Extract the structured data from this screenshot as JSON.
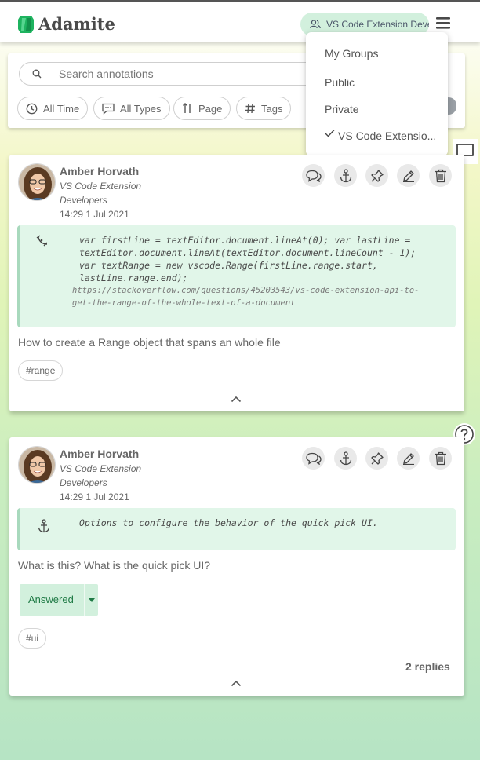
{
  "app": {
    "name": "Adamite",
    "brand_color": "#2bbd6c"
  },
  "header": {
    "group_label": "VS Code Extension Developers"
  },
  "search": {
    "placeholder": "Search annotations"
  },
  "filters": [
    {
      "label": "All Time",
      "icon": "clock-icon"
    },
    {
      "label": "All Types",
      "icon": "comment-dots-icon"
    },
    {
      "label": "Page",
      "icon": "sort-icon"
    },
    {
      "label": "Tags",
      "icon": "hash-icon"
    }
  ],
  "group_menu": {
    "items": [
      "My Groups",
      "Public",
      "Private",
      "VS Code Extensio..."
    ],
    "selected": "VS Code Extensio..."
  },
  "annotations": [
    {
      "author": "Amber Horvath",
      "group_line1": "VS Code Extension",
      "group_line2": "Developers",
      "time": "14:29 1 Jul 2021",
      "anchor_icon": "highlighter-icon",
      "code_lines": [
        "var firstLine = textEditor.document.lineAt(0); var lastLine =",
        "textEditor.document.lineAt(textEditor.document.lineCount - 1);",
        "var textRange = new vscode.Range(firstLine.range.start,",
        "lastLine.range.end);"
      ],
      "url_lines": [
        "https://stackoverflow.com/questions/45203543/vs-code-extension-api-to-",
        "get-the-range-of-the-whole-text-of-a-document"
      ],
      "text": "How to create a Range object that spans an whole file",
      "tags": [
        "#range"
      ]
    },
    {
      "author": "Amber Horvath",
      "group_line1": "VS Code Extension",
      "group_line2": "Developers",
      "time": "14:29 1 Jul 2021",
      "anchor_icon": "anchor-icon",
      "code_lines": [
        "Options to configure the behavior of the quick pick UI."
      ],
      "text": "What is this? What is the quick pick UI?",
      "status": "Answered",
      "tags": [
        "#ui"
      ],
      "replies": "2 replies"
    }
  ],
  "colors": {
    "anchor_bg": "#e1f6e9",
    "answered_text": "#1f7a45",
    "answered_bg": "#d2f0dd"
  }
}
